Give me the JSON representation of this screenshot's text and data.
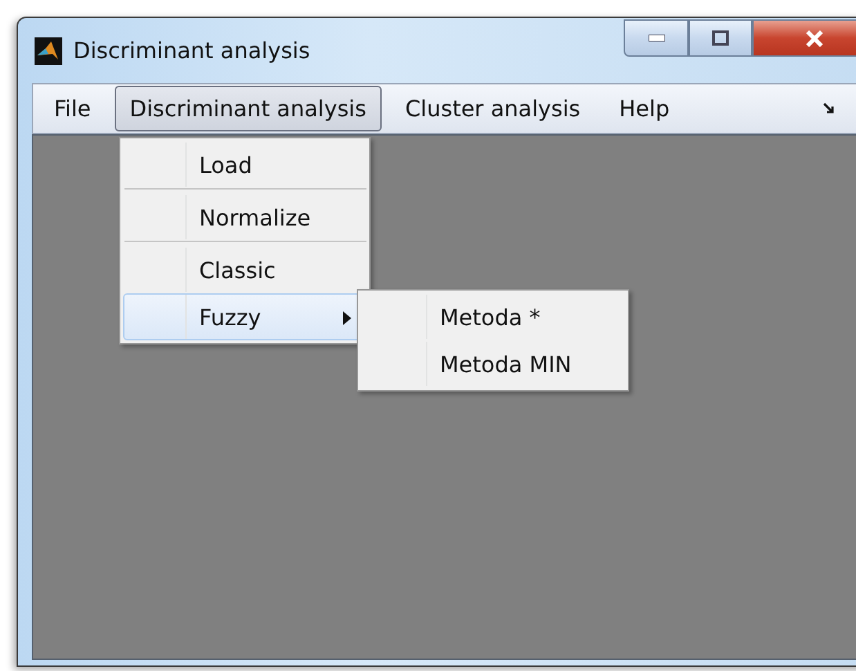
{
  "window": {
    "title": "Discriminant analysis"
  },
  "menu_bar": [
    {
      "label": "File",
      "selected": false
    },
    {
      "label": "Discriminant analysis",
      "selected": true
    },
    {
      "label": "Cluster analysis",
      "selected": false
    },
    {
      "label": "Help",
      "selected": false
    }
  ],
  "dropdown": [
    {
      "kind": "item",
      "label": "Load",
      "selected": false,
      "submenu": false
    },
    {
      "kind": "separator"
    },
    {
      "kind": "item",
      "label": "Normalize",
      "selected": false,
      "submenu": false
    },
    {
      "kind": "separator"
    },
    {
      "kind": "item",
      "label": "Classic",
      "selected": false,
      "submenu": false
    },
    {
      "kind": "item",
      "label": "Fuzzy",
      "selected": true,
      "submenu": true
    }
  ],
  "submenu": [
    {
      "label": "Metoda *",
      "selected": false
    },
    {
      "label": "Metoda MIN",
      "selected": false
    }
  ]
}
